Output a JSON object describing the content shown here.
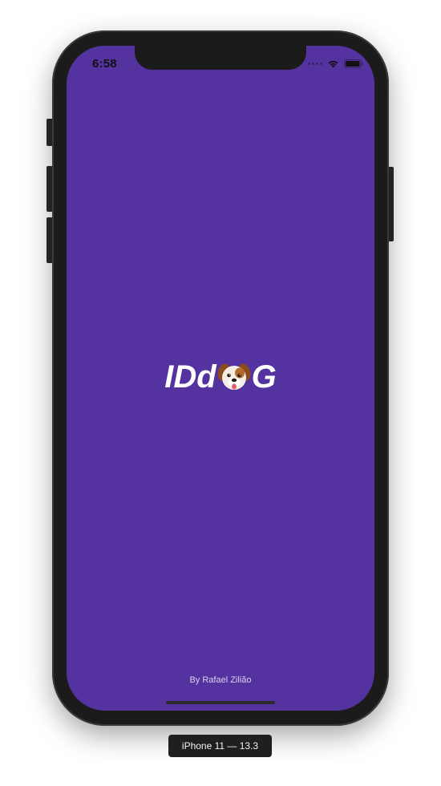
{
  "colors": {
    "background": "#5433A0",
    "logo_text": "#FFFFFF",
    "author_text": "#D9D2EE",
    "device_frame": "#1B1B1B"
  },
  "status_bar": {
    "time": "6:58",
    "icons": [
      "cellular-signal-icon",
      "wifi-icon",
      "battery-icon"
    ]
  },
  "splash": {
    "logo_prefix": "IDd",
    "logo_icon": "dog-face-icon",
    "logo_suffix": "G",
    "author": "By Rafael Zilião"
  },
  "device_label": "iPhone 11 — 13.3"
}
